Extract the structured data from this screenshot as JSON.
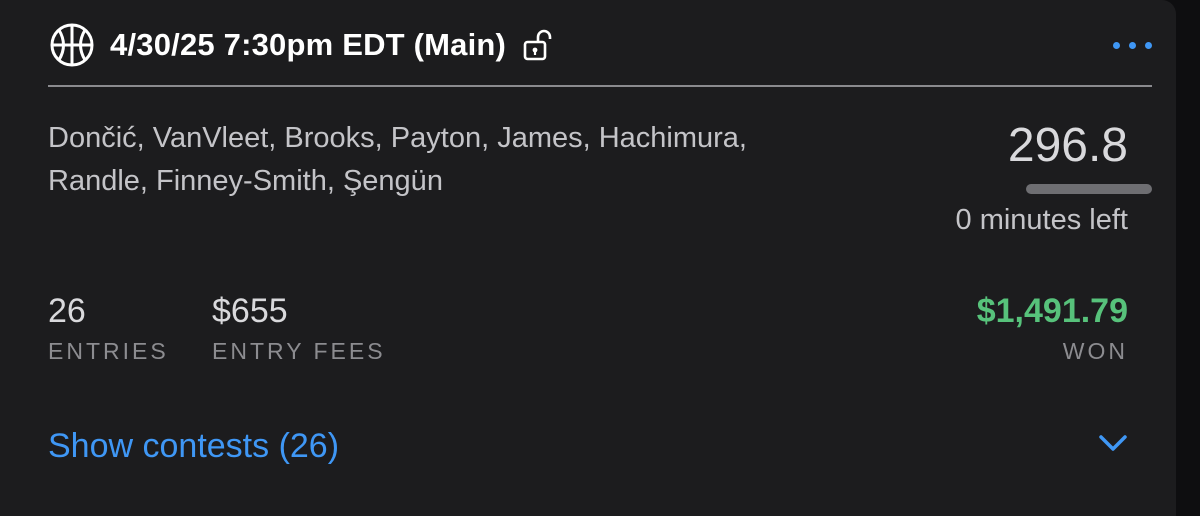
{
  "header": {
    "sport_icon": "basketball-icon",
    "title": "4/30/25 7:30pm EDT (Main)",
    "lock_icon": "unlocked-icon",
    "more_icon": "more-dots-icon"
  },
  "lineup": {
    "players_line1": "Dončić, VanVleet, Brooks, Payton, James, Hachimura,",
    "players_line2": "Randle, Finney-Smith, Şengün"
  },
  "score": {
    "points": "296.8",
    "time_remaining_fraction": 0,
    "time_left_label": "0 minutes left"
  },
  "stats": {
    "entries_value": "26",
    "entries_label": "ENTRIES",
    "fees_value": "$655",
    "fees_label": "ENTRY FEES",
    "won_value": "$1,491.79",
    "won_label": "WON"
  },
  "footer": {
    "show_contests_label": "Show contests (26)",
    "expand_icon": "chevron-down-icon"
  },
  "colors": {
    "accent": "#3f97f5",
    "won": "#57c27b",
    "card_bg": "#1c1c1e"
  }
}
